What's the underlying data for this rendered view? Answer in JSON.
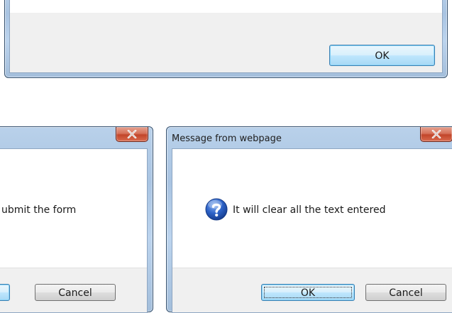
{
  "dialog_top": {
    "ok_label": "OK"
  },
  "dialog_confirm_submit": {
    "message": "ubmit the form",
    "cancel_label": "Cancel"
  },
  "dialog_confirm_clear": {
    "title": "Message from webpage",
    "message": "It will clear all the text entered",
    "ok_label": "OK",
    "cancel_label": "Cancel"
  },
  "icons": {
    "close": "close-icon",
    "question": "question-icon"
  },
  "colors": {
    "frame_blue": "#b9d1ea",
    "close_red": "#c2452a",
    "default_button_blue": "#bee6fd",
    "footer_gray": "#f0f0f0"
  }
}
